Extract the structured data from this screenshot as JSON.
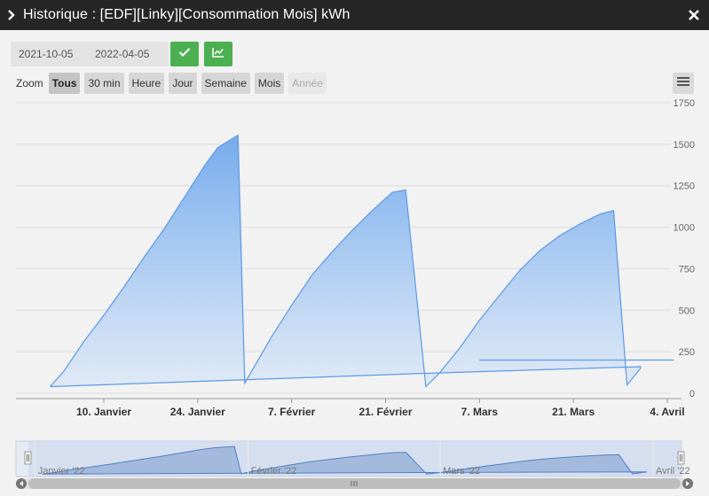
{
  "window": {
    "title": "Historique : [EDF][Linky][Consommation Mois] kWh"
  },
  "toolbar": {
    "date_start": "2021-10-05",
    "date_end": "2022-04-05"
  },
  "zoom": {
    "label": "Zoom",
    "buttons": [
      {
        "label": "Tous",
        "state": "active"
      },
      {
        "label": "30 min",
        "state": "normal"
      },
      {
        "label": "Heure",
        "state": "normal"
      },
      {
        "label": "Jour",
        "state": "normal"
      },
      {
        "label": "Semaine",
        "state": "normal"
      },
      {
        "label": "Mois",
        "state": "normal"
      },
      {
        "label": "Année",
        "state": "disabled"
      }
    ]
  },
  "icons": {
    "title": "chevron-right-icon",
    "close": "close-icon",
    "ok": "check-icon",
    "chart": "line-chart-icon",
    "menu": "hamburger-menu-icon"
  },
  "colors": {
    "titlebar": "#262626",
    "accent": "#4caf50",
    "series_line": "#5b9ae6",
    "series_fill": "#7cb2ee",
    "navigator_fill": "#8fa9d6"
  },
  "chart_data": {
    "type": "area",
    "ylim": [
      0,
      1750
    ],
    "y_ticks": [
      "0",
      "250",
      "500",
      "750",
      "1000",
      "1250",
      "1500",
      "1750"
    ],
    "x_ticks": [
      {
        "label": "10. Janvier",
        "date": "2022-01-10"
      },
      {
        "label": "24. Janvier",
        "date": "2022-01-24"
      },
      {
        "label": "7. Février",
        "date": "2022-02-07"
      },
      {
        "label": "21. Février",
        "date": "2022-02-21"
      },
      {
        "label": "7. Mars",
        "date": "2022-03-07"
      },
      {
        "label": "21. Mars",
        "date": "2022-03-21"
      },
      {
        "label": "4. Avril",
        "date": "2022-04-04"
      }
    ],
    "series": [
      {
        "points": [
          [
            "2022-01-02",
            40
          ],
          [
            "2022-01-04",
            130
          ],
          [
            "2022-01-07",
            310
          ],
          [
            "2022-01-10",
            470
          ],
          [
            "2022-01-13",
            640
          ],
          [
            "2022-01-16",
            820
          ],
          [
            "2022-01-19",
            990
          ],
          [
            "2022-01-22",
            1180
          ],
          [
            "2022-01-25",
            1370
          ],
          [
            "2022-01-27",
            1480
          ],
          [
            "2022-01-30",
            1555
          ],
          [
            "2022-01-31",
            60
          ],
          [
            "2022-02-01",
            130
          ],
          [
            "2022-02-04",
            340
          ],
          [
            "2022-02-07",
            530
          ],
          [
            "2022-02-10",
            710
          ],
          [
            "2022-02-13",
            850
          ],
          [
            "2022-02-16",
            980
          ],
          [
            "2022-02-19",
            1100
          ],
          [
            "2022-02-22",
            1210
          ],
          [
            "2022-02-24",
            1225
          ],
          [
            "2022-02-27",
            40
          ],
          [
            "2022-03-01",
            120
          ],
          [
            "2022-03-04",
            270
          ],
          [
            "2022-03-07",
            440
          ],
          [
            "2022-03-10",
            590
          ],
          [
            "2022-03-13",
            740
          ],
          [
            "2022-03-16",
            860
          ],
          [
            "2022-03-19",
            950
          ],
          [
            "2022-03-22",
            1020
          ],
          [
            "2022-03-25",
            1080
          ],
          [
            "2022-03-27",
            1100
          ],
          [
            "2022-03-29",
            50
          ],
          [
            "2022-03-31",
            150
          ],
          [
            "2022-03-31",
            160
          ],
          [
            "2022-02-27",
            120
          ],
          [
            "2022-01-02",
            40
          ]
        ]
      }
    ],
    "navigator": {
      "x_ticks": [
        {
          "label": "Janvier '22",
          "date": "2022-01-01"
        },
        {
          "label": "Février '22",
          "date": "2022-02-01"
        },
        {
          "label": "Mars '22",
          "date": "2022-03-01"
        },
        {
          "label": "Avril '22",
          "date": "2022-04-01"
        }
      ]
    },
    "grid": true,
    "legend": "none"
  }
}
